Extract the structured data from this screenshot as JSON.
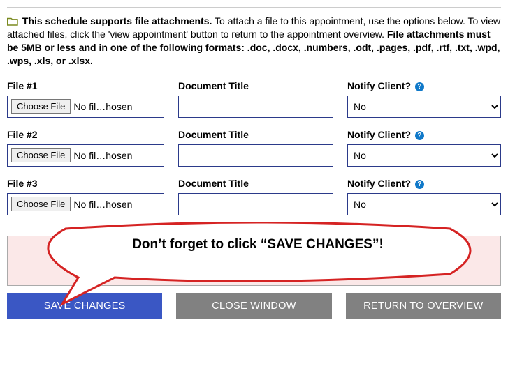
{
  "intro": {
    "lead": "This schedule supports file attachments.",
    "body": "To attach a file to this appointment, use the options below. To view attached files, click the 'view appointment' button to return to the appointment overview. ",
    "formats": "File attachments must be 5MB or less and in one of the following formats: .doc, .docx, .numbers, .odt, .pages, .pdf, .rtf, .txt, .wpd, .wps, .xls, or .xlsx."
  },
  "labels": {
    "doc_title": "Document Title",
    "notify": "Notify Client?"
  },
  "rows": [
    {
      "file_label": "File #1",
      "choose": "Choose File",
      "status": "No fil…hosen",
      "notify_value": "No"
    },
    {
      "file_label": "File #2",
      "choose": "Choose File",
      "status": "No fil…hosen",
      "notify_value": "No"
    },
    {
      "file_label": "File #3",
      "choose": "Choose File",
      "status": "No fil…hosen",
      "notify_value": "No"
    }
  ],
  "callout": "Don’t forget to click “SAVE CHANGES”!",
  "buttons": {
    "save": "SAVE CHANGES",
    "close": "CLOSE WINDOW",
    "return": "RETURN TO OVERVIEW"
  },
  "help_glyph": "?"
}
